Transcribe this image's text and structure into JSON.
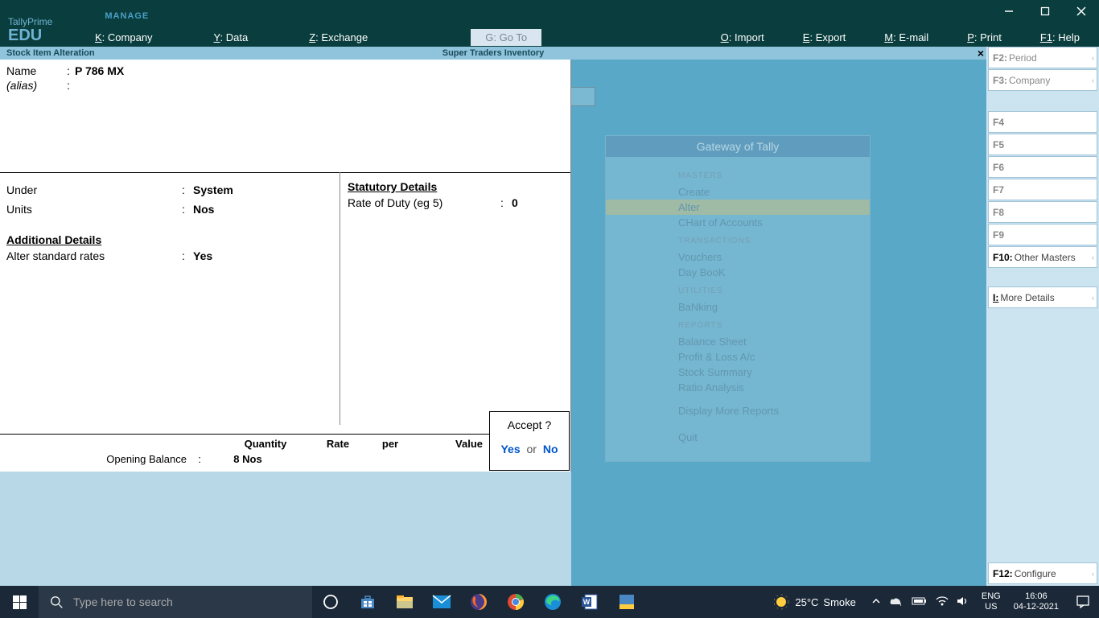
{
  "app": {
    "name": "TallyPrime",
    "edition": "EDU",
    "manage": "MANAGE"
  },
  "menu": {
    "company": {
      "key": "K",
      "label": "Company"
    },
    "data": {
      "key": "Y",
      "label": "Data"
    },
    "exchange": {
      "key": "Z",
      "label": "Exchange"
    },
    "goto": {
      "key": "G",
      "label": "Go To"
    },
    "import": {
      "key": "O",
      "label": "Import"
    },
    "export": {
      "key": "E",
      "label": "Export"
    },
    "email": {
      "key": "M",
      "label": "E-mail"
    },
    "print": {
      "key": "P",
      "label": "Print"
    },
    "help": {
      "key": "F1",
      "label": "Help"
    }
  },
  "context": {
    "title": "Stock Item Alteration",
    "middle": "Super Traders  Inventory"
  },
  "form": {
    "name_label": "Name",
    "name_value": "P 786 MX",
    "alias_label": "(alias)",
    "alias_value": "",
    "under_label": "Under",
    "under_value": "System",
    "units_label": "Units",
    "units_value": "Nos",
    "additional_heading": "Additional Details",
    "alter_rates_label": "Alter standard rates",
    "alter_rates_value": "Yes",
    "statutory_heading": "Statutory Details",
    "duty_label": "Rate of Duty (eg 5)",
    "duty_value": "0"
  },
  "bottom": {
    "quantity_h": "Quantity",
    "rate_h": "Rate",
    "per_h": "per",
    "value_h": "Value",
    "opening_label": "Opening Balance",
    "opening_qty": "8 Nos"
  },
  "accept": {
    "question": "Accept ?",
    "yes": "Yes",
    "or": "or",
    "no": "No"
  },
  "gateway": {
    "title": "Gateway of Tally",
    "masters": "MASTERS",
    "create": "Create",
    "alter": "Alter",
    "chart": "CHart of Accounts",
    "transactions": "TRANSACTIONS",
    "vouchers": "Vouchers",
    "daybook": "Day BooK",
    "utilities": "UTILITIES",
    "banking": "BaNking",
    "reports": "REPORTS",
    "balance": "Balance Sheet",
    "pl": "Profit & Loss A/c",
    "stock": "Stock Summary",
    "ratio": "Ratio Analysis",
    "display": "Display More Reports",
    "quit": "Quit"
  },
  "fn": {
    "f2": {
      "key": "F2:",
      "label": "Period"
    },
    "f3": {
      "key": "F3:",
      "label": "Company"
    },
    "f4": {
      "key": "F4",
      "label": ""
    },
    "f5": {
      "key": "F5",
      "label": ""
    },
    "f6": {
      "key": "F6",
      "label": ""
    },
    "f7": {
      "key": "F7",
      "label": ""
    },
    "f8": {
      "key": "F8",
      "label": ""
    },
    "f9": {
      "key": "F9",
      "label": ""
    },
    "f10": {
      "key": "F10:",
      "label": "Other Masters"
    },
    "i": {
      "key": "I:",
      "label": "More Details"
    },
    "f12": {
      "key": "F12:",
      "label": "Configure"
    }
  },
  "taskbar": {
    "search_placeholder": "Type here to search",
    "weather_temp": "25°C",
    "weather_cond": "Smoke",
    "lang1": "ENG",
    "lang2": "US",
    "time": "16:06",
    "date": "04-12-2021"
  }
}
